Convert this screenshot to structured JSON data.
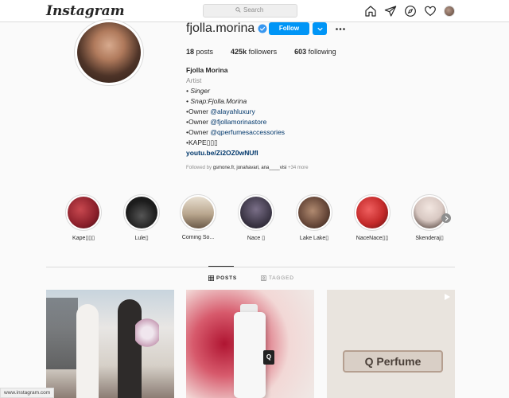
{
  "header": {
    "logo": "Instagram",
    "search_placeholder": "Search",
    "nav_icons": [
      "home-icon",
      "direct-icon",
      "explore-icon",
      "activity-heart-icon",
      "profile-avatar"
    ]
  },
  "profile": {
    "username": "fjolla.morina",
    "verified": true,
    "follow_label": "Follow",
    "stats": {
      "posts_count": "18",
      "posts_label": "posts",
      "followers_count": "425k",
      "followers_label": "followers",
      "following_count": "603",
      "following_label": "following"
    },
    "bio": {
      "name": "Fjolla Morina",
      "category": "Artist",
      "line1": "• Singer",
      "line2": "• Snap:Fjolla.Morina",
      "line3_prefix": "•Owner ",
      "line3_link": "@alayahluxury",
      "line4_prefix": "•Owner ",
      "line4_link": "@fjollamorinastore",
      "line5_prefix": "•Owner ",
      "line5_link": "@qperfumesaccessories",
      "line6": "•KAPE▯▯▯",
      "url": "youtu.be/Zi2OZ0wNUfI"
    },
    "followed_by_prefix": "Followed by ",
    "followed_by_names": "gsmone.fr, jonahavari, ana____visi",
    "followed_by_more": " +34 more"
  },
  "highlights": [
    {
      "label": "Kape▯▯▯",
      "color": "#8a1f2a"
    },
    {
      "label": "Lule▯",
      "color": "#1c1c1c"
    },
    {
      "label": "Coming So...",
      "color": "#b9a68e"
    },
    {
      "label": "Nace ▯",
      "color": "#3e3848"
    },
    {
      "label": "Lake Lake▯",
      "color": "#6b4b3c"
    },
    {
      "label": "NaceNace▯▯",
      "color": "#c42a2a"
    },
    {
      "label": "Skenderaj▯",
      "color": "#d8c8c2"
    }
  ],
  "tabs": {
    "posts": "POSTS",
    "tagged": "TAGGED"
  },
  "posts": [
    {
      "label": "",
      "kind": "photo"
    },
    {
      "label": "Q",
      "kind": "photo"
    },
    {
      "label": "Q Perfume",
      "kind": "video"
    }
  ],
  "status_bar": "www.instagram.com"
}
